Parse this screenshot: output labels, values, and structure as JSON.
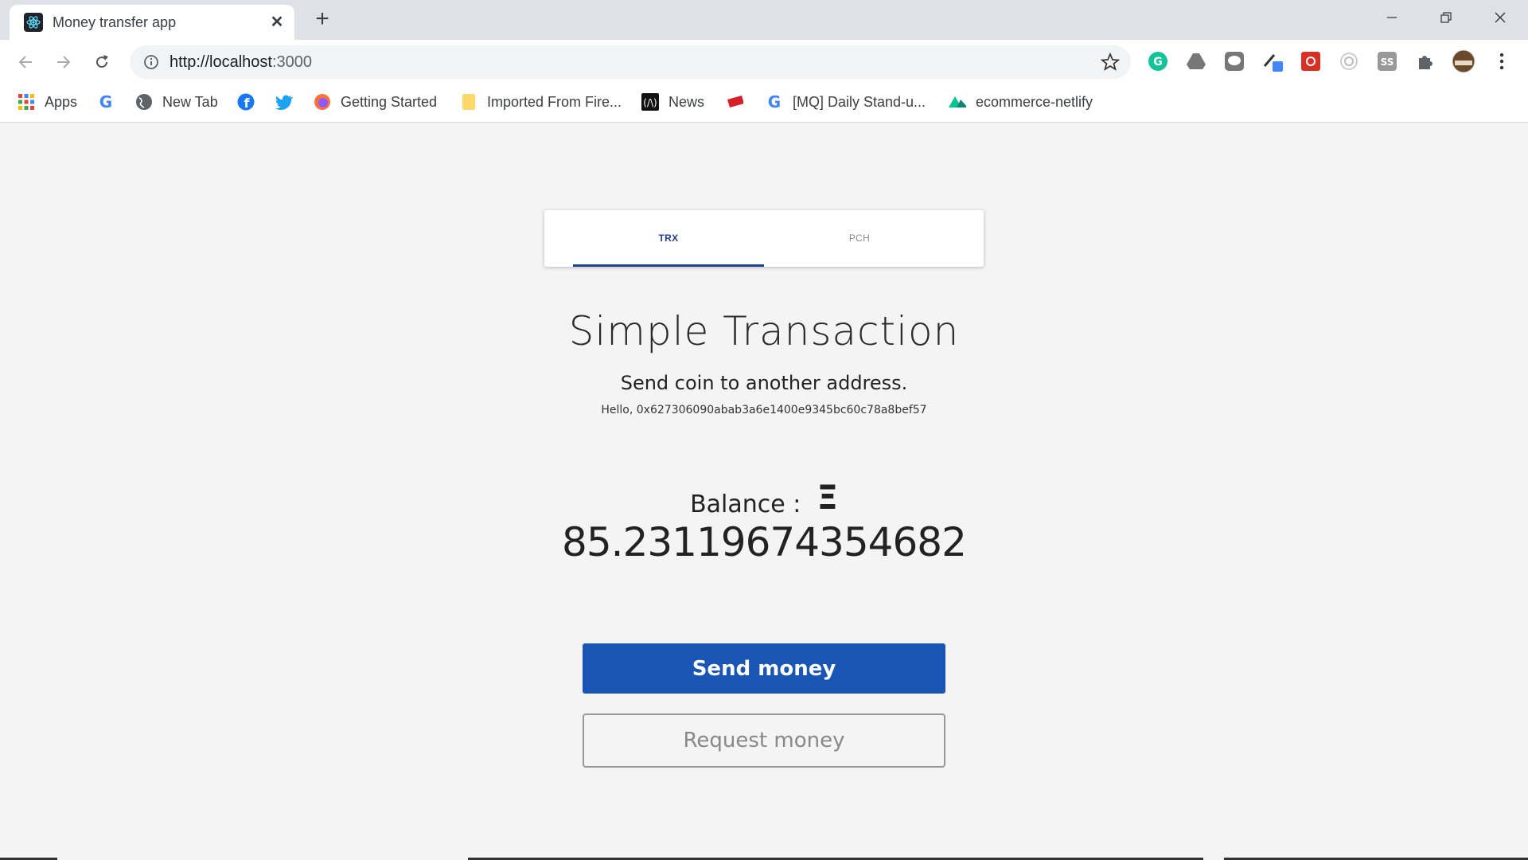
{
  "browser": {
    "tab_title": "Money transfer app",
    "url_host": "http://localhost",
    "url_port": ":3000"
  },
  "bookmarks": [
    {
      "label": "Apps"
    },
    {
      "label": ""
    },
    {
      "label": "New Tab"
    },
    {
      "label": ""
    },
    {
      "label": ""
    },
    {
      "label": "Getting Started"
    },
    {
      "label": "Imported From Fire..."
    },
    {
      "label": "News"
    },
    {
      "label": ""
    },
    {
      "label": "[MQ] Daily Stand-u..."
    },
    {
      "label": "ecommerce-netlify"
    }
  ],
  "tabs": [
    {
      "label": "TRX",
      "active": true
    },
    {
      "label": "PCH",
      "active": false
    }
  ],
  "main": {
    "title": "Simple Transaction",
    "subtitle": "Send coin to another address.",
    "hello": "Hello, 0x627306090abab3a6e1400e9345bc60c78a8bef57",
    "balance_label": "Balance :",
    "currency_symbol": "Ξ",
    "balance_value": "85.23119674354682",
    "send_label": "Send money",
    "request_label": "Request money"
  },
  "colors": {
    "primary": "#1b55b4",
    "tab_active": "#1f3f8f",
    "background": "#f4f4f4"
  }
}
